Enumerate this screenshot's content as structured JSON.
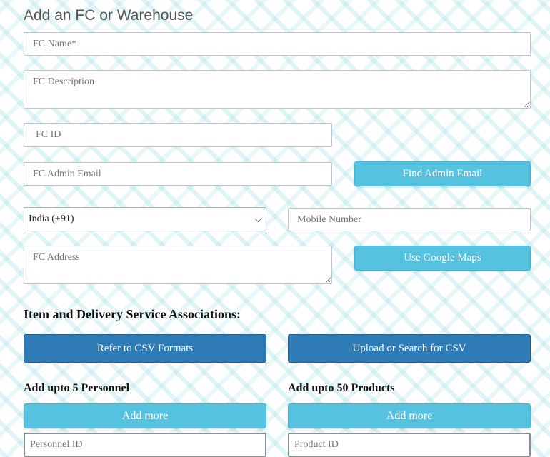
{
  "form": {
    "title": "Add an FC or Warehouse",
    "fc_name_placeholder": "FC Name*",
    "fc_description_placeholder": "FC Description",
    "fc_id_placeholder": "FC ID",
    "fc_admin_email_placeholder": "FC Admin Email",
    "find_admin_email_label": "Find Admin Email",
    "country_code_selected": "India (+91)",
    "mobile_number_placeholder": "Mobile Number",
    "fc_address_placeholder": "FC Address",
    "use_google_maps_label": "Use Google Maps"
  },
  "associations": {
    "title": "Item and Delivery Service Associations:",
    "refer_csv_label": "Refer to CSV Formats",
    "upload_csv_label": "Upload or Search for CSV"
  },
  "personnel": {
    "title": "Add upto 5 Personnel",
    "add_more_label": "Add more",
    "id_placeholder": "Personnel ID"
  },
  "products": {
    "title": "Add upto 50 Products",
    "add_more_label": "Add more",
    "id_placeholder": "Product ID"
  },
  "colors": {
    "light_button": "#55c2e0",
    "dark_button": "#2f7bb6",
    "background_pattern": "#96dce2"
  },
  "icons": {
    "select_caret": "chevron-down-icon"
  }
}
